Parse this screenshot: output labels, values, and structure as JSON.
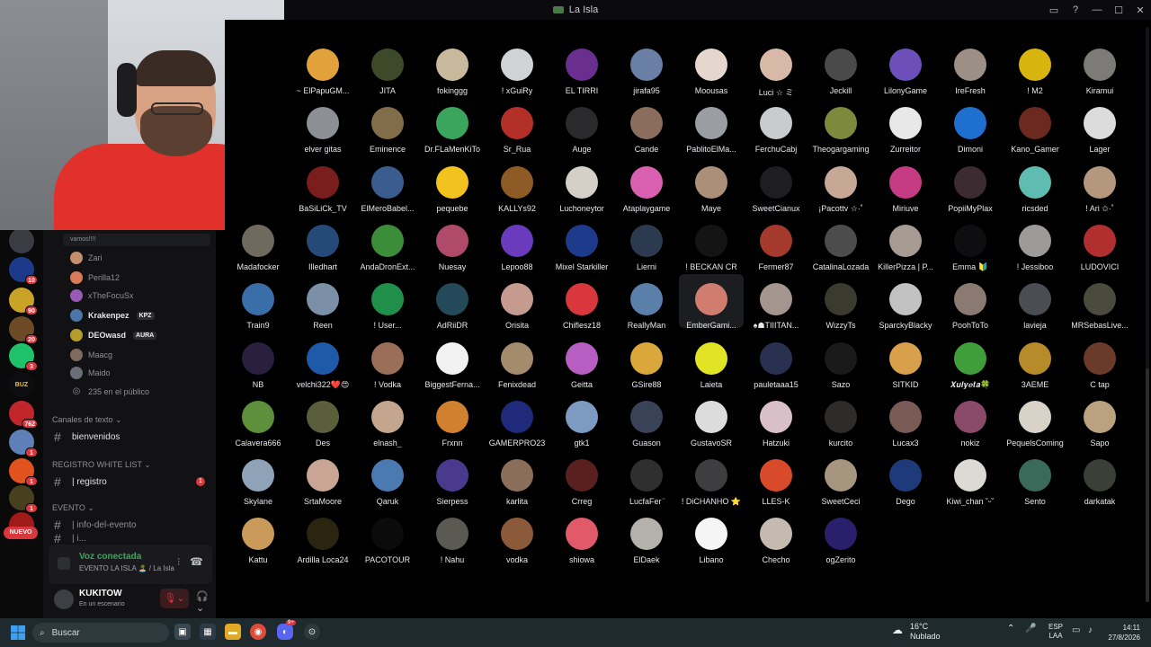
{
  "window": {
    "title": "La Isla"
  },
  "sidebar": {
    "voice_users_message": "vamos!!!!",
    "voice_users": [
      {
        "name": "Zari",
        "color": "#c58e6c",
        "bright": false,
        "tag": ""
      },
      {
        "name": "Perilla12",
        "color": "#d97b5a",
        "bright": false,
        "tag": ""
      },
      {
        "name": "xTheFocuSx",
        "color": "#9b59b6",
        "bright": false,
        "tag": ""
      },
      {
        "name": "Krakenpez",
        "color": "#4b77a8",
        "bright": true,
        "tag": "KPZ"
      },
      {
        "name": "DEOwasd",
        "color": "#b49d2a",
        "bright": true,
        "tag": "AURA"
      },
      {
        "name": "Maacg",
        "color": "#7f6b5e",
        "bright": false,
        "tag": ""
      },
      {
        "name": "Maido",
        "color": "#6b6e75",
        "bright": false,
        "tag": ""
      }
    ],
    "audience": "235 en el público",
    "categories": {
      "text": "Canales de texto",
      "whitelist": "REGISTRO WHITE LIST",
      "event": "EVENTO"
    },
    "channels": {
      "bienvenidos": "bienvenidos",
      "registro": "| registro",
      "registro_badge": "1",
      "info_evento": "| info-del-evento",
      "partial": "| i..."
    }
  },
  "voice": {
    "status": "Voz conectada",
    "location": "EVENTO LA ISLA 🏝️ / La Isla"
  },
  "user": {
    "name": "KUKITOW",
    "status": "En un escenario"
  },
  "server_rail": {
    "badges": [
      "10",
      "90",
      "20",
      "3",
      "762",
      "1",
      "1",
      "1"
    ],
    "nuevo": "NUEVO"
  },
  "stage": {
    "participants": [
      {
        "name": "~ ElPapuGM...",
        "color": "#e1a23b"
      },
      {
        "name": "JITA",
        "color": "#3d4a2a"
      },
      {
        "name": "fokinggg",
        "color": "#c8b89c"
      },
      {
        "name": "! xGuiRy",
        "color": "#cfd3d6"
      },
      {
        "name": "EL TIRRI",
        "color": "#6a2f8e"
      },
      {
        "name": "jirafa95",
        "color": "#6a7fa6"
      },
      {
        "name": "Moousas",
        "color": "#e5d7cd"
      },
      {
        "name": "Luci ☆ ミ",
        "color": "#d8b9a8"
      },
      {
        "name": "Jeckill",
        "color": "#4a4a4a"
      },
      {
        "name": "LilonyGame",
        "color": "#6c4fb8"
      },
      {
        "name": "IreFresh",
        "color": "#9c8f86"
      },
      {
        "name": "! M2",
        "color": "#d8b40e"
      },
      {
        "name": "Kiramui",
        "color": "#7d7b78"
      },
      {
        "name": "elver gitas",
        "color": "#8c8f94"
      },
      {
        "name": "Eminence",
        "color": "#826d4a"
      },
      {
        "name": "Dr.FLaMenKiTo",
        "color": "#3ba55d"
      },
      {
        "name": "Sr_Rua",
        "color": "#b33029"
      },
      {
        "name": "Auge",
        "color": "#2a2a2c"
      },
      {
        "name": "Cande",
        "color": "#8a6d5c"
      },
      {
        "name": "PablitoElMa...",
        "color": "#9a9ea3"
      },
      {
        "name": "FerchuCabj",
        "color": "#c9cbce"
      },
      {
        "name": "Theogargaming",
        "color": "#7d8a3e"
      },
      {
        "name": "Zurreitor",
        "color": "#e8e8e8"
      },
      {
        "name": "Dimoni",
        "color": "#1f6fcf"
      },
      {
        "name": "Kano_Gamer",
        "color": "#6b2a1d"
      },
      {
        "name": "Lager",
        "color": "#dcdcdc"
      },
      {
        "name": "BaSiLiCk_TV",
        "color": "#7a1d1d"
      },
      {
        "name": "ElMeroBabel...",
        "color": "#3b5c8e"
      },
      {
        "name": "pequebe",
        "color": "#f2c31f"
      },
      {
        "name": "KALLYs92",
        "color": "#8e5a26"
      },
      {
        "name": "Luchoneytor",
        "color": "#d4d0c8"
      },
      {
        "name": "Ataplaygame",
        "color": "#d95fb0"
      },
      {
        "name": "Maye",
        "color": "#ab8f79"
      },
      {
        "name": "SweetCianux",
        "color": "#1d1d22"
      },
      {
        "name": "¡Pacottv ☆·˚",
        "color": "#c7a796"
      },
      {
        "name": "Miriuve",
        "color": "#c63c84"
      },
      {
        "name": "PopiiMyPlax",
        "color": "#3c2b30"
      },
      {
        "name": "ricsded",
        "color": "#5fbcb0"
      },
      {
        "name": "! Ari ✩·˚",
        "color": "#b5977e"
      },
      {
        "name": "Madafocker",
        "color": "#6e6a5d"
      },
      {
        "name": "Illedhart",
        "color": "#264a78"
      },
      {
        "name": "AndaDronExt...",
        "color": "#3c8d3a"
      },
      {
        "name": "Nuesay",
        "color": "#b04a6a"
      },
      {
        "name": "Lepoo88",
        "color": "#6a3bbd"
      },
      {
        "name": "Mixel Starkiller",
        "color": "#1e3a8a"
      },
      {
        "name": "Lierni",
        "color": "#2b3a4f"
      },
      {
        "name": "! BECKAN CR",
        "color": "#141414"
      },
      {
        "name": "Fermer87",
        "color": "#a33a2c"
      },
      {
        "name": "CatalinaLozada",
        "color": "#4c4c4c"
      },
      {
        "name": "KillerPizza | P...",
        "color": "#a79c93"
      },
      {
        "name": "Emma 🔰",
        "color": "#0e0e10"
      },
      {
        "name": "! Jessiboo",
        "color": "#9d9a98"
      },
      {
        "name": "LUDOVICI",
        "color": "#b12f2f"
      },
      {
        "name": "Train9",
        "color": "#3a6ea8"
      },
      {
        "name": "Reen",
        "color": "#7b8fa6"
      },
      {
        "name": "! User...",
        "color": "#1f8f4a"
      },
      {
        "name": "AdRiiDR",
        "color": "#244a5a"
      },
      {
        "name": "Orisita",
        "color": "#c49b8e"
      },
      {
        "name": "Chiflesz18",
        "color": "#da373c"
      },
      {
        "name": "ReallyMan",
        "color": "#5a7fa8"
      },
      {
        "name": "EmberGami...",
        "color": "#d07c6e"
      },
      {
        "name": "♠☗TIIITAN...",
        "color": "#a4958e"
      },
      {
        "name": "WizzyTs",
        "color": "#3a3a2f"
      },
      {
        "name": "SparckyBlacky",
        "color": "#c2c2c2"
      },
      {
        "name": "PoohToTo",
        "color": "#8a7a72"
      },
      {
        "name": "lavieja",
        "color": "#4a4d52"
      },
      {
        "name": "MRSebasLive...",
        "color": "#4a4b3d"
      },
      {
        "name": "NB",
        "color": "#2a1f3d"
      },
      {
        "name": "velchi322❤️😍",
        "color": "#1f5aa8"
      },
      {
        "name": "! Vodka",
        "color": "#9a6e58"
      },
      {
        "name": "BiggestFerna...",
        "color": "#f2f2f2"
      },
      {
        "name": "Fenixdead",
        "color": "#a48b6c"
      },
      {
        "name": "Geitta",
        "color": "#b65ec2"
      },
      {
        "name": "GSire88",
        "color": "#d9a73a"
      },
      {
        "name": "Laieta",
        "color": "#e1e424"
      },
      {
        "name": "pauletaaa15",
        "color": "#2a3050"
      },
      {
        "name": "Sazo",
        "color": "#1a1a1a"
      },
      {
        "name": "SITKID",
        "color": "#d8a04a"
      },
      {
        "name": "𝑿𝒖𝒍𝒚𝒆𝒕𝒂🍀",
        "color": "#3f9e39"
      },
      {
        "name": "3AEME",
        "color": "#b78b2a"
      },
      {
        "name": "C tap",
        "color": "#6a3a2a"
      },
      {
        "name": "Calavera666",
        "color": "#5e8f3a"
      },
      {
        "name": "Des",
        "color": "#5a5e3a"
      },
      {
        "name": "elnash_",
        "color": "#c4a58e"
      },
      {
        "name": "Frxnn",
        "color": "#d1802f"
      },
      {
        "name": "GAMERPRO23",
        "color": "#1f2a7a"
      },
      {
        "name": "gtk1",
        "color": "#7d9ac0"
      },
      {
        "name": "Guason",
        "color": "#3a4258"
      },
      {
        "name": "GustavoSR",
        "color": "#dcdcdc"
      },
      {
        "name": "Hatzuki",
        "color": "#d9c0c8"
      },
      {
        "name": "kurcito",
        "color": "#2e2b28"
      },
      {
        "name": "Lucax3",
        "color": "#7a5a55"
      },
      {
        "name": "nokiz",
        "color": "#8a4a6a"
      },
      {
        "name": "PequelsComing",
        "color": "#d8d2c8"
      },
      {
        "name": "Sapo",
        "color": "#b9a27d"
      },
      {
        "name": "Skylane",
        "color": "#8fa3b8"
      },
      {
        "name": "SrtaMoore",
        "color": "#caa596"
      },
      {
        "name": "Qaruk",
        "color": "#4a7ab0"
      },
      {
        "name": "Sierpess",
        "color": "#4a3a8e"
      },
      {
        "name": "karlita",
        "color": "#8a6e5a"
      },
      {
        "name": "Crreg",
        "color": "#5a2020"
      },
      {
        "name": "LucfaFer ̈",
        "color": "#2f2f30"
      },
      {
        "name": "! DiCHANHO ⭐",
        "color": "#3e3e40"
      },
      {
        "name": "LLES-K",
        "color": "#d94a2a"
      },
      {
        "name": "SweetCeci",
        "color": "#a7967f"
      },
      {
        "name": "Dego",
        "color": "#1f3a7a"
      },
      {
        "name": "Kiwi_chan ˘ᵕ˘",
        "color": "#dcdad2"
      },
      {
        "name": "Sento",
        "color": "#3a6a5a"
      },
      {
        "name": "darkatak",
        "color": "#3a4036"
      },
      {
        "name": "Kattu",
        "color": "#c99a5a"
      },
      {
        "name": "Ardilla Loca24",
        "color": "#2a2410"
      },
      {
        "name": "PACOTOUR",
        "color": "#0b0b0b"
      },
      {
        "name": "! Nahu",
        "color": "#5a5a52"
      },
      {
        "name": "vodka",
        "color": "#8a5a3a"
      },
      {
        "name": "shiowa",
        "color": "#e05a6a"
      },
      {
        "name": "ElDaek",
        "color": "#b4b0ab"
      },
      {
        "name": "Libano",
        "color": "#f5f5f5"
      },
      {
        "name": "Checho",
        "color": "#c4bab0"
      },
      {
        "name": "ogZerito",
        "color": "#2a1f6a"
      }
    ]
  },
  "taskbar": {
    "search_placeholder": "Buscar",
    "weather_temp": "16°C",
    "weather_desc": "Nublado",
    "lang1": "ESP",
    "lang2": "LAA",
    "time": "14:11",
    "date": "27/8/2026",
    "discord_badge": "9+"
  }
}
